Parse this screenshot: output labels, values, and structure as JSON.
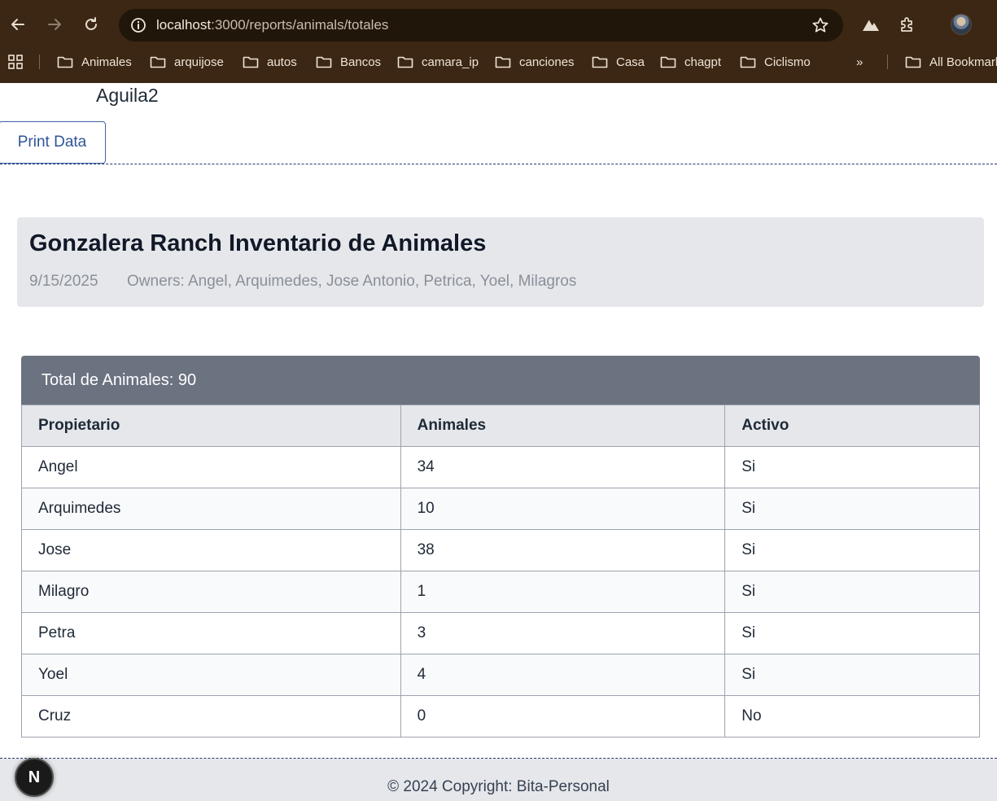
{
  "browser": {
    "url_host": "localhost",
    "url_rest": ":3000/reports/animals/totales",
    "bookmarks": [
      "Animales",
      "arquijose",
      "autos",
      "Bancos",
      "camara_ip",
      "canciones",
      "Casa",
      "chagpt",
      "Ciclismo"
    ],
    "all_bookmarks": "All Bookmarks",
    "overflow_glyph": "»"
  },
  "page": {
    "brand": "Aguila2",
    "print_button": "Print Data"
  },
  "report": {
    "title": "Gonzalera Ranch Inventario de Animales",
    "date": "9/15/2025",
    "owners": "Owners: Angel, Arquimedes, Jose Antonio, Petrica, Yoel, Milagros",
    "total_label": "Total de Animales: 90",
    "columns": [
      "Propietario",
      "Animales",
      "Activo"
    ],
    "rows": [
      [
        "Angel",
        "34",
        "Si"
      ],
      [
        "Arquimedes",
        "10",
        "Si"
      ],
      [
        "Jose",
        "38",
        "Si"
      ],
      [
        "Milagro",
        "1",
        "Si"
      ],
      [
        "Petra",
        "3",
        "Si"
      ],
      [
        "Yoel",
        "4",
        "Si"
      ],
      [
        "Cruz",
        "0",
        "No"
      ]
    ]
  },
  "footer": {
    "copyright": "© 2024 Copyright: Bita-Personal",
    "badge": "N"
  }
}
